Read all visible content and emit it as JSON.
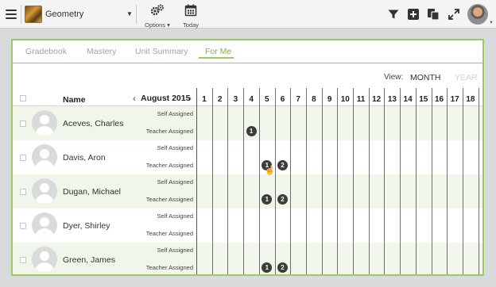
{
  "toolbar": {
    "course_name": "Geometry",
    "options_label": "Options",
    "today_label": "Today"
  },
  "tabs": [
    {
      "label": "Gradebook",
      "active": false
    },
    {
      "label": "Mastery",
      "active": false
    },
    {
      "label": "Unit Summary",
      "active": false
    },
    {
      "label": "For Me",
      "active": true
    }
  ],
  "view": {
    "label": "View:",
    "month": "MONTH",
    "year": "YEAR"
  },
  "table": {
    "name_header": "Name",
    "month_label": "August 2015",
    "days": [
      "1",
      "2",
      "3",
      "4",
      "5",
      "6",
      "7",
      "8",
      "9",
      "10",
      "11",
      "12",
      "13",
      "14",
      "15",
      "16",
      "17",
      "18"
    ],
    "self_label": "Self Assigned",
    "teacher_label": "Teacher Assigned",
    "students": [
      {
        "name": "Aceves, Charles",
        "teacher_badges": [
          {
            "day": 4,
            "value": "1"
          }
        ]
      },
      {
        "name": "Davis, Aron",
        "teacher_badges": [
          {
            "day": 5,
            "value": "1"
          },
          {
            "day": 6,
            "value": "2"
          }
        ]
      },
      {
        "name": "Dugan, Michael",
        "teacher_badges": [
          {
            "day": 5,
            "value": "1"
          },
          {
            "day": 6,
            "value": "2"
          }
        ]
      },
      {
        "name": "Dyer, Shirley",
        "teacher_badges": []
      },
      {
        "name": "Green, James",
        "teacher_badges": [
          {
            "day": 5,
            "value": "1"
          },
          {
            "day": 6,
            "value": "2"
          }
        ]
      }
    ]
  },
  "colors": {
    "accent": "#9cc964",
    "row_alt": "#f1f6ea",
    "badge": "#3c3c3c"
  }
}
